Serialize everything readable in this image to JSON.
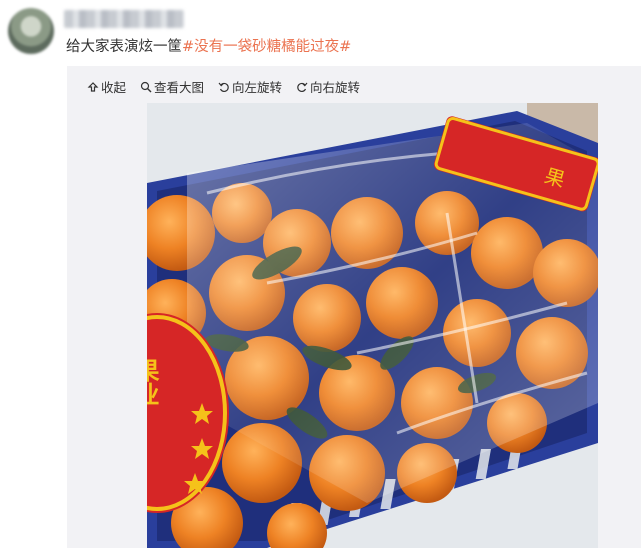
{
  "post": {
    "username": "",
    "text": "给大家表演炫一筐",
    "hashtag": "#没有一袋砂糖橘能过夜#"
  },
  "toolbar": {
    "collapse_label": "收起",
    "view_large_label": "查看大图",
    "rotate_left_label": "向左旋转",
    "rotate_right_label": "向右旋转"
  },
  "photo": {
    "label_left_text": "果业",
    "label_right_text": "果"
  },
  "colors": {
    "accent": "#eb7350",
    "crate_blue": "#2a3f9c",
    "label_red": "#d62626",
    "label_yellow": "#f5c21a",
    "orange": "#f0892b"
  }
}
